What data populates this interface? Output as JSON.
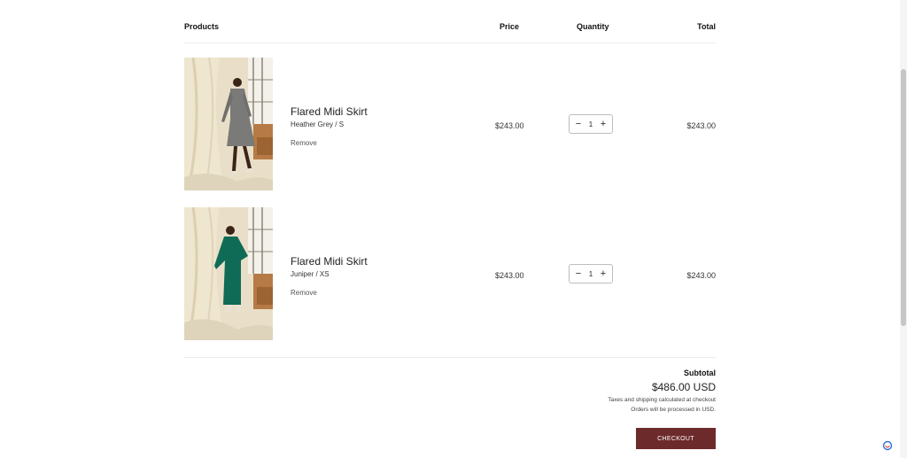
{
  "header": {
    "products": "Products",
    "price": "Price",
    "quantity": "Quantity",
    "total": "Total"
  },
  "items": [
    {
      "title": "Flared Midi Skirt",
      "variant": "Heather Grey / S",
      "remove": "Remove",
      "price": "$243.00",
      "quantity": "1",
      "total": "$243.00",
      "image_icon": "product-photo-grey-dress",
      "garment_color": "#7a7a78"
    },
    {
      "title": "Flared Midi Skirt",
      "variant": "Juniper / XS",
      "remove": "Remove",
      "price": "$243.00",
      "quantity": "1",
      "total": "$243.00",
      "image_icon": "product-photo-green-dress",
      "garment_color": "#0f6b56"
    }
  ],
  "qty_controls": {
    "minus": "−",
    "plus": "+"
  },
  "summary": {
    "subtotal_label": "Subtotal",
    "subtotal_amount": "$486.00 USD",
    "tax_note": "Taxes and shipping calculated at checkout",
    "orders_note": "Orders will be processed in USD.",
    "checkout_label": "CHECKOUT"
  },
  "colors": {
    "checkout_button": "#6d2a2a",
    "chat_icon": "#2f6fe0"
  }
}
